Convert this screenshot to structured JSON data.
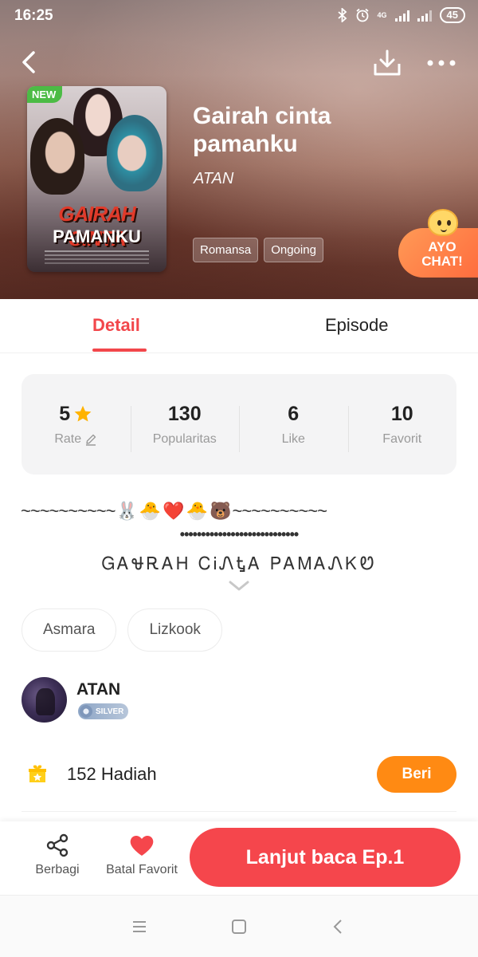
{
  "status_bar": {
    "time": "16:25",
    "network": "4G",
    "battery": "45"
  },
  "header": {
    "new_badge": "NEW",
    "title": "Gairah cinta pamanku",
    "author": "ATAN",
    "tags": [
      "Romansa",
      "Ongoing"
    ],
    "cover": {
      "title_line1": "GAIRAH CINTA",
      "title_line2": "PAMANKU"
    },
    "ayo_chat": {
      "line1": "AYO",
      "line2": "CHAT!"
    }
  },
  "tabs": [
    {
      "label": "Detail",
      "active": true
    },
    {
      "label": "Episode",
      "active": false
    }
  ],
  "stats": [
    {
      "value": "5",
      "label": "Rate",
      "icon": "star-icon"
    },
    {
      "value": "130",
      "label": "Popularitas"
    },
    {
      "value": "6",
      "label": "Like"
    },
    {
      "value": "10",
      "label": "Favorit"
    }
  ],
  "description": {
    "line1_left": "~~~~~~~~~~",
    "line1_emojis": [
      "🐰",
      "🐣",
      "❤️",
      "🐣",
      "🐻"
    ],
    "line1_right": "~~~~~~~~~~",
    "line2": "••••••••••••••••••••••••••••",
    "line3": "ᏀᎪᏠᎡᎪᎻ ᏟᎥᏁᎿᎪ ᏢᎪᎷᎪᏁᏦᏬ"
  },
  "keywords": [
    "Asmara",
    "Lizkook"
  ],
  "author_section": {
    "name": "ATAN",
    "badge": "SILVER"
  },
  "gift": {
    "count": "152",
    "label": "Hadiah",
    "button": "Beri"
  },
  "actions": {
    "share_label": "Berbagi",
    "favorite_label": "Batal Favorit",
    "read_label": "Lanjut baca Ep.1"
  },
  "colors": {
    "accent": "#f5464c",
    "gift_button": "#ff8a13",
    "new_badge": "#4cbb45",
    "star": "#ffb300"
  }
}
